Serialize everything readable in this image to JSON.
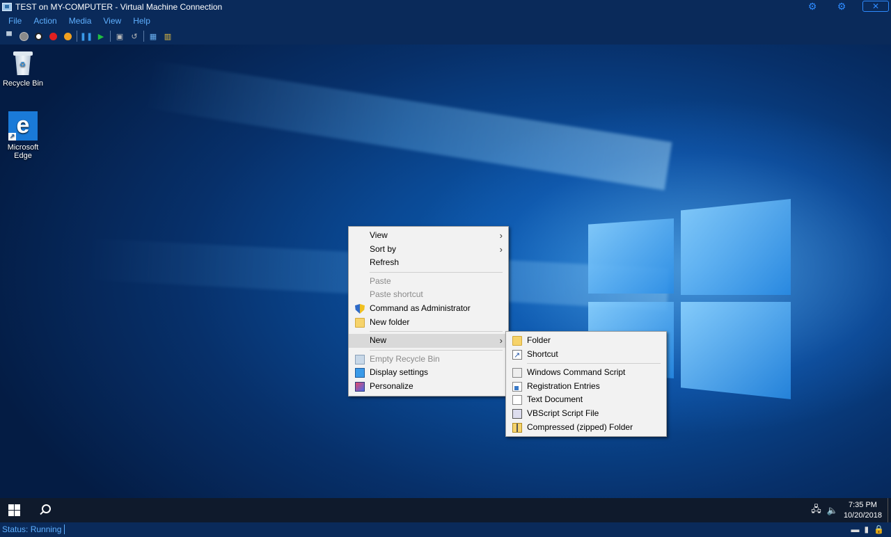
{
  "window": {
    "title": "TEST on MY-COMPUTER - Virtual Machine Connection",
    "close_glyph": "✕"
  },
  "menubar": [
    "File",
    "Action",
    "Media",
    "View",
    "Help"
  ],
  "toolbar": {
    "icons": [
      "ctrl-alt-del-icon",
      "start-icon",
      "turn-off-icon",
      "shut-down-icon",
      "save-icon",
      "pause-icon",
      "resume-icon",
      "checkpoint-icon",
      "revert-icon",
      "enhanced-session-icon",
      "share-icon"
    ],
    "colors": {
      "turn_off": "#e02020",
      "shut_down": "#e04040",
      "save": "#f0a020",
      "pause": "#3a9ae8",
      "resume": "#20c040"
    }
  },
  "desktop": {
    "icons": [
      {
        "label": "Recycle Bin"
      },
      {
        "label": "Microsoft Edge"
      }
    ]
  },
  "context_menu": {
    "items": [
      {
        "label": "View",
        "submenu": true
      },
      {
        "label": "Sort by",
        "submenu": true
      },
      {
        "label": "Refresh"
      },
      {
        "label": "Paste",
        "disabled": true
      },
      {
        "label": "Paste shortcut",
        "disabled": true
      },
      {
        "label": "Command as Administrator",
        "icon": "shield-icon"
      },
      {
        "label": "New folder",
        "icon": "folder-icon"
      },
      {
        "label": "New",
        "submenu": true,
        "active": true
      },
      {
        "label": "Empty Recycle Bin",
        "icon": "recycle-bin-icon",
        "disabled": true
      },
      {
        "label": "Display settings",
        "icon": "display-icon"
      },
      {
        "label": "Personalize",
        "icon": "personalize-icon"
      }
    ]
  },
  "new_submenu": {
    "items": [
      {
        "label": "Folder",
        "icon": "folder-icon"
      },
      {
        "label": "Shortcut",
        "icon": "shortcut-icon"
      },
      {
        "label": "Windows Command Script",
        "icon": "cmd-script-icon"
      },
      {
        "label": "Registration Entries",
        "icon": "registry-icon"
      },
      {
        "label": "Text Document",
        "icon": "text-document-icon"
      },
      {
        "label": "VBScript Script File",
        "icon": "vbscript-icon"
      },
      {
        "label": "Compressed (zipped) Folder",
        "icon": "zip-folder-icon"
      }
    ]
  },
  "taskbar": {
    "time": "7:35 PM",
    "date": "10/20/2018"
  },
  "statusbar": {
    "status": "Status: Running"
  }
}
